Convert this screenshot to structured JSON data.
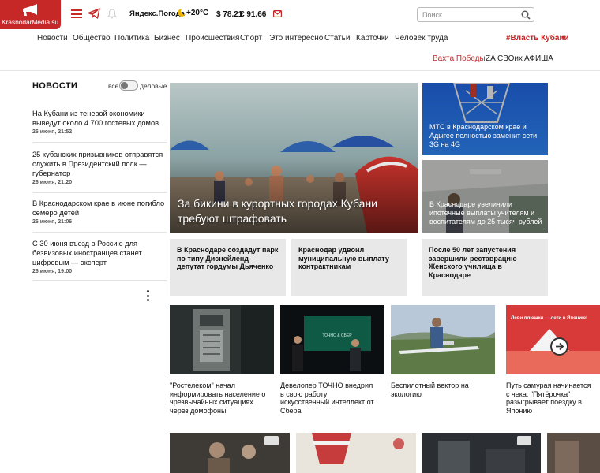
{
  "brand": {
    "logo_text": "KrasnodarMedia.su",
    "color": "#c62828"
  },
  "header": {
    "weather_brand": "Яндекс.Погода",
    "weather_temp": "+20°C",
    "usd": "$ 78.21",
    "eur": "€ 91.66",
    "search_placeholder": "Поиск"
  },
  "nav": {
    "items": [
      "Новости",
      "Общество",
      "Политика",
      "Бизнес",
      "Происшествия",
      "Спорт",
      "Это интересно",
      "Статьи",
      "Карточки",
      "Человек труда"
    ],
    "special": "#Власть Кубани",
    "sub": [
      "Вахта Победы",
      "ZA СВОих",
      "АФИША"
    ]
  },
  "sidebar": {
    "heading": "НОВОСТИ",
    "filter_all": "все",
    "filter_business": "деловые",
    "items": [
      {
        "title": "На Кубани из теневой экономики выведут около 4 700 гостевых домов",
        "date": "26 июня, 21:52"
      },
      {
        "title": "25 кубанских призывников отправятся служить в Президентский полк — губернатор",
        "date": "26 июня, 21:20"
      },
      {
        "title": "В Краснодарском крае в июне погибло семеро детей",
        "date": "26 июня, 21:06"
      },
      {
        "title": "С 30 июня въезд в Россию для безвизовых иностранцев станет цифровым — эксперт",
        "date": "26 июня, 19:00"
      }
    ]
  },
  "main": {
    "hero_title": "За бикини в курортных городах Кубани требуют штрафовать",
    "side_cards": [
      {
        "title": "МТС в Краснодарском крае и Адыгее полностью заменит сети 3G на 4G"
      },
      {
        "title": "В Краснодаре увеличили ипотечные выплаты учителям и воспитателям до 25 тысяч рублей"
      }
    ],
    "gray_cards": [
      {
        "title": "В Краснодаре создадут парк по типу Диснейленд — депутат гордумы Дьяченко"
      },
      {
        "title": "Краснодар удвоил муниципальную выплату контрактникам"
      },
      {
        "title": "После 50 лет запустения завершили реставрацию Женского училища в Краснодаре"
      }
    ],
    "row_cards": [
      {
        "title": "\"Ростелеком\" начал информировать население о чрезвычайных ситуациях через домофоны"
      },
      {
        "title": "Девелопер ТОЧНО внедрил в свою работу искусственный интеллект от Сбера"
      },
      {
        "title": "Беспилотный вектор на экологию"
      },
      {
        "title": "Путь самурая начинается с чека: \"Пятёрочка\" разыгрывает поездку в Японию"
      }
    ],
    "promo_text": "Лови плюшки — лети в Японию!",
    "slide_text": "ТОЧНО & СБЕР"
  }
}
